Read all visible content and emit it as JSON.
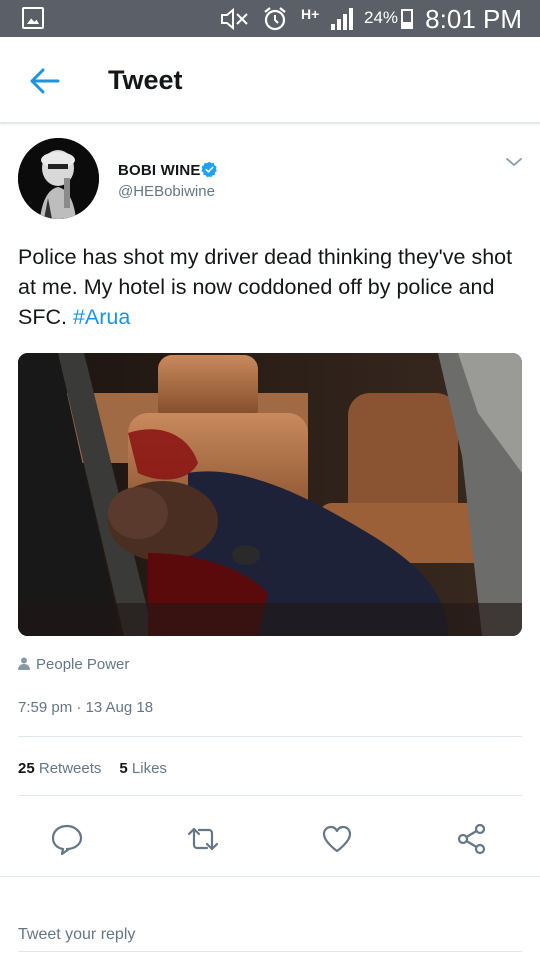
{
  "status_bar": {
    "battery_percent": "24%",
    "time": "8:01 PM",
    "network": "H+",
    "icons": [
      "gallery-icon",
      "mute-icon",
      "alarm-icon",
      "network-type-icon",
      "signal-icon",
      "battery-icon"
    ]
  },
  "header": {
    "back_icon": "arrow-left-icon",
    "title": "Tweet"
  },
  "tweet": {
    "author_name": "BOBI WINE",
    "verified": true,
    "handle": "@HEBobiwine",
    "text": "Police has shot my driver dead thinking they've shot at me. My hotel is now coddoned off by police and SFC. ",
    "hashtag": "#Arua",
    "location": "People Power",
    "timestamp": "7:59 pm · 13 Aug 18",
    "retweets_count": "25",
    "retweets_label": "Retweets",
    "likes_count": "5",
    "likes_label": "Likes"
  },
  "actions": {
    "reply_icon": "reply-icon",
    "retweet_icon": "retweet-icon",
    "like_icon": "heart-icon",
    "share_icon": "share-icon"
  },
  "reply": {
    "placeholder": "Tweet your reply"
  },
  "colors": {
    "accent": "#1b95e0",
    "status_bar": "#5b6068",
    "text_primary": "#14171a",
    "text_secondary": "#657786",
    "divider": "#e1e8ed"
  }
}
